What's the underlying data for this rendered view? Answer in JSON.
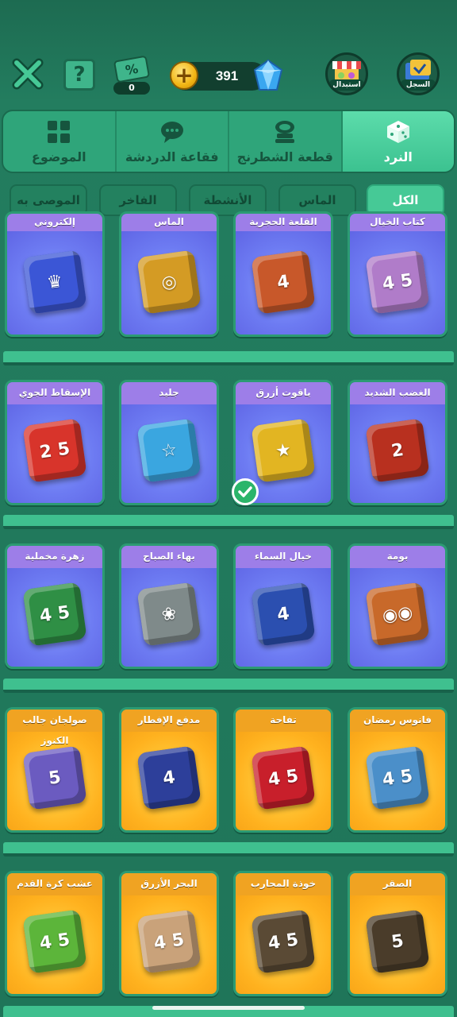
{
  "topbar": {
    "coupon_count": "0",
    "coin_amount": "391",
    "exchange_label": "استبدال",
    "record_label": "السجل",
    "coupon_symbol": "%",
    "help_symbol": "?"
  },
  "tabs": [
    {
      "label": "النرد",
      "icon": "dice-icon",
      "active": true
    },
    {
      "label": "قطعة الشطرنج",
      "icon": "chess-piece-icon",
      "active": false
    },
    {
      "label": "فقاعة الدردشة",
      "icon": "chat-bubble-icon",
      "active": false
    },
    {
      "label": "الموضوع",
      "icon": "theme-grid-icon",
      "active": false
    }
  ],
  "filters": [
    {
      "label": "الكل",
      "active": true
    },
    {
      "label": "الماس",
      "active": false
    },
    {
      "label": "الأنشطة",
      "active": false
    },
    {
      "label": "الفاخر",
      "active": false
    },
    {
      "label": "الموصى به",
      "active": false
    }
  ],
  "rows": [
    [
      {
        "name": "كتاب الخيال",
        "style": "purple",
        "dice_color": "#b07cc9",
        "dice_text": "4 5"
      },
      {
        "name": "القلعة الحجرية",
        "style": "purple",
        "dice_color": "#c8582a",
        "dice_text": "4"
      },
      {
        "name": "الماس",
        "style": "purple",
        "dice_color": "#d49b24",
        "dice_text": "◎"
      },
      {
        "name": "إلكتروني",
        "style": "purple",
        "dice_color": "#3b56d6",
        "dice_text": "♛"
      }
    ],
    [
      {
        "name": "الغضب الشديد",
        "style": "purple",
        "dice_color": "#b8301f",
        "dice_text": "2"
      },
      {
        "name": "ياقوت أزرق",
        "style": "purple",
        "dice_color": "#e2b522",
        "dice_text": "★",
        "selected": true
      },
      {
        "name": "جليد",
        "style": "purple",
        "dice_color": "#3aa6e0",
        "dice_text": "☆"
      },
      {
        "name": "الإسقاط الجوي",
        "style": "purple",
        "dice_color": "#d8342b",
        "dice_text": "2 5"
      }
    ],
    [
      {
        "name": "بومة",
        "style": "purple",
        "dice_color": "#c8692a",
        "dice_text": "◉◉"
      },
      {
        "name": "خيال السماء",
        "style": "purple",
        "dice_color": "#2b4fb0",
        "dice_text": "4"
      },
      {
        "name": "بهاء الصباح",
        "style": "purple",
        "dice_color": "#7f8a8a",
        "dice_text": "❀"
      },
      {
        "name": "زهرة مخملية",
        "style": "purple",
        "dice_color": "#2f8f45",
        "dice_text": "4 5"
      }
    ],
    [
      {
        "name": "فانوس رمضان",
        "style": "gold",
        "dice_color": "#4b8fc9",
        "dice_text": "4 5"
      },
      {
        "name": "تفاحة",
        "style": "gold",
        "dice_color": "#c81f2b",
        "dice_text": "4 5"
      },
      {
        "name": "مدفع الإفطار",
        "style": "gold",
        "dice_color": "#2d3f9a",
        "dice_text": "4"
      },
      {
        "name": "صولجان جالب الكنوز",
        "style": "gold",
        "dice_color": "#6b5bc0",
        "dice_text": "5"
      }
    ],
    [
      {
        "name": "الصقر",
        "style": "gold",
        "dice_color": "#4a3c2a",
        "dice_text": "5"
      },
      {
        "name": "خوذة المحارب",
        "style": "gold",
        "dice_color": "#5a4a35",
        "dice_text": "4 5"
      },
      {
        "name": "البحر الأزرق",
        "style": "gold",
        "dice_color": "#c9a27a",
        "dice_text": "4 5"
      },
      {
        "name": "عشب كرة القدم",
        "style": "gold",
        "dice_color": "#5cb53a",
        "dice_text": "4 5"
      }
    ]
  ],
  "colors": {
    "background": "#1f7559",
    "tab_active": "#4fd2a0",
    "chip_active": "#46c996",
    "purple_card": "#6d7bf2",
    "gold_card": "#ffb21f"
  }
}
